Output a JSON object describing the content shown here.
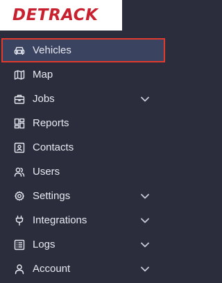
{
  "app": {
    "logo_text": "DETRACK"
  },
  "colors": {
    "sidebar_bg": "#2b2d3d",
    "active_bg": "#3a4360",
    "highlight": "#e23b2e",
    "brand": "#c8202e"
  },
  "sidebar": {
    "items": [
      {
        "label": "Vehicles",
        "icon": "vehicle-icon",
        "active": true,
        "expandable": false
      },
      {
        "label": "Map",
        "icon": "map-icon",
        "active": false,
        "expandable": false
      },
      {
        "label": "Jobs",
        "icon": "briefcase-icon",
        "active": false,
        "expandable": true
      },
      {
        "label": "Reports",
        "icon": "dashboard-icon",
        "active": false,
        "expandable": false
      },
      {
        "label": "Contacts",
        "icon": "contact-card-icon",
        "active": false,
        "expandable": false
      },
      {
        "label": "Users",
        "icon": "users-icon",
        "active": false,
        "expandable": false
      },
      {
        "label": "Settings",
        "icon": "gear-icon",
        "active": false,
        "expandable": true
      },
      {
        "label": "Integrations",
        "icon": "plug-icon",
        "active": false,
        "expandable": true
      },
      {
        "label": "Logs",
        "icon": "log-list-icon",
        "active": false,
        "expandable": true
      },
      {
        "label": "Account",
        "icon": "user-icon",
        "active": false,
        "expandable": true
      }
    ]
  }
}
